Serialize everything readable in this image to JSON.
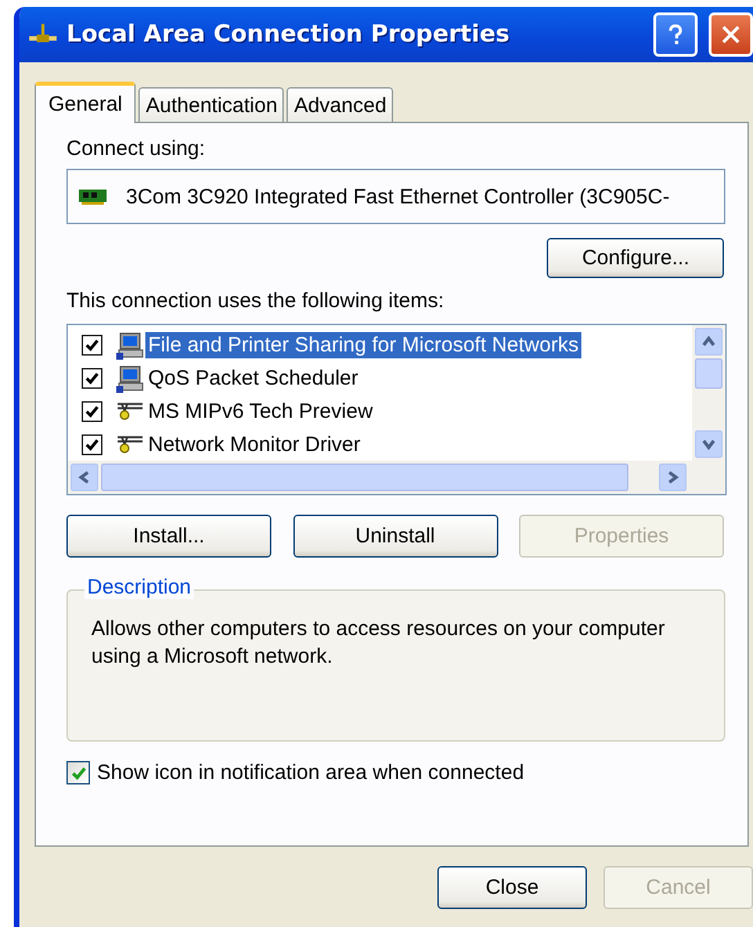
{
  "window": {
    "title": "Local Area Connection Properties"
  },
  "tabs": [
    {
      "label": "General",
      "selected": true
    },
    {
      "label": "Authentication",
      "selected": false
    },
    {
      "label": "Advanced",
      "selected": false
    }
  ],
  "connect_using": {
    "label": "Connect using:",
    "adapter": "3Com 3C920 Integrated Fast Ethernet Controller (3C905C-"
  },
  "configure_button": {
    "label": "Configure...",
    "disabled": false
  },
  "items_label": "This connection uses the following items:",
  "items": [
    {
      "kind": "service",
      "label": "File and Printer Sharing for Microsoft Networks",
      "checked": true,
      "selected": true
    },
    {
      "kind": "service",
      "label": "QoS Packet Scheduler",
      "checked": true,
      "selected": false
    },
    {
      "kind": "protocol",
      "label": "MS MIPv6 Tech Preview",
      "checked": true,
      "selected": false
    },
    {
      "kind": "protocol",
      "label": "Network Monitor Driver",
      "checked": true,
      "selected": false
    }
  ],
  "item_buttons": [
    {
      "label": "Install...",
      "disabled": false
    },
    {
      "label": "Uninstall",
      "disabled": false
    },
    {
      "label": "Properties",
      "disabled": true
    }
  ],
  "description": {
    "title": "Description",
    "text": "Allows other computers to access resources on your computer using a Microsoft network."
  },
  "show_icon": {
    "label": "Show icon in notification area when connected",
    "checked": true
  },
  "dialog_buttons": [
    {
      "label": "Close",
      "disabled": false
    },
    {
      "label": "Cancel",
      "disabled": true
    }
  ]
}
